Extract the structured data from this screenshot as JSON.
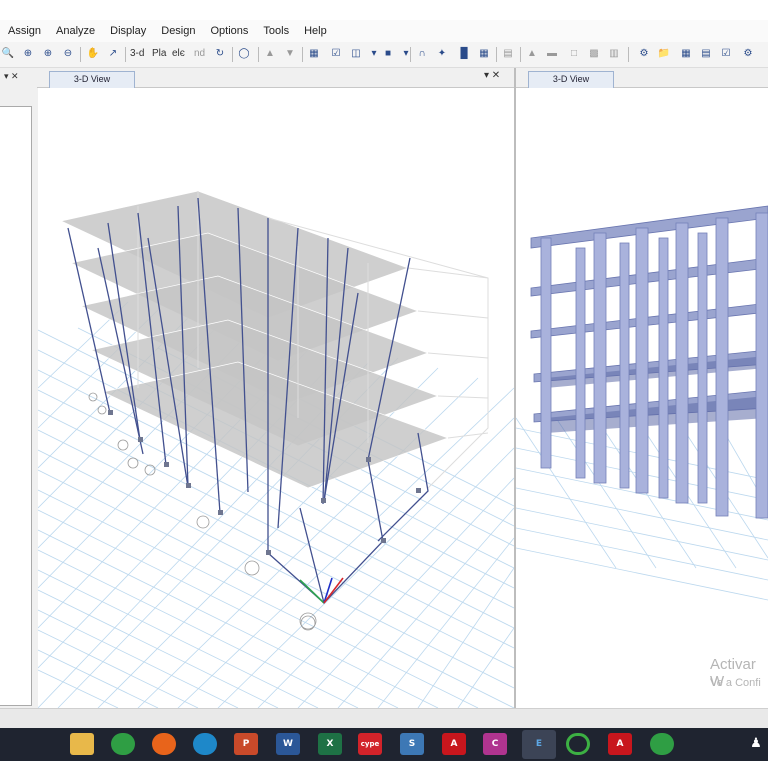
{
  "menu": [
    "Assign",
    "Analyze",
    "Display",
    "Design",
    "Options",
    "Tools",
    "Help"
  ],
  "toolbar": {
    "view_3d_label": "3-d",
    "plan_label": "Pla",
    "elev_label": "elє",
    "nd_label": "nd"
  },
  "left_pane": {
    "controls": "▾ ✕"
  },
  "view1": {
    "tab_label": "3-D View",
    "controls": "▾ ✕"
  },
  "view2": {
    "tab_label": "3-D View"
  },
  "watermark": {
    "line1": "Activar W",
    "line2": "Ve a Confi"
  },
  "taskbar": {
    "apps": [
      {
        "name": "file-explorer",
        "label": "",
        "color": "#e8b84a"
      },
      {
        "name": "chrome",
        "label": "",
        "color": "#2f9e44"
      },
      {
        "name": "firefox",
        "label": "",
        "color": "#e8641b"
      },
      {
        "name": "edge",
        "label": "",
        "color": "#1e88c9"
      },
      {
        "name": "powerpoint",
        "label": "P",
        "color": "#c94a2a"
      },
      {
        "name": "word",
        "label": "W",
        "color": "#2b5797"
      },
      {
        "name": "excel",
        "label": "X",
        "color": "#1e7145"
      },
      {
        "name": "cype",
        "label": "cype",
        "color": "#d2232a"
      },
      {
        "name": "safe",
        "label": "S",
        "color": "#3d78b5"
      },
      {
        "name": "autocad",
        "label": "A",
        "color": "#c8161d"
      },
      {
        "name": "civil3d",
        "label": "C",
        "color": "#b0348f"
      },
      {
        "name": "etabs",
        "label": "E",
        "color": "#2d79c7"
      },
      {
        "name": "spinner",
        "label": "",
        "color": "#3cb043"
      },
      {
        "name": "autocad-2",
        "label": "A",
        "color": "#c8161d"
      },
      {
        "name": "chrome-2",
        "label": "",
        "color": "#2f9e44"
      }
    ],
    "tray_icon": "person-icon"
  }
}
